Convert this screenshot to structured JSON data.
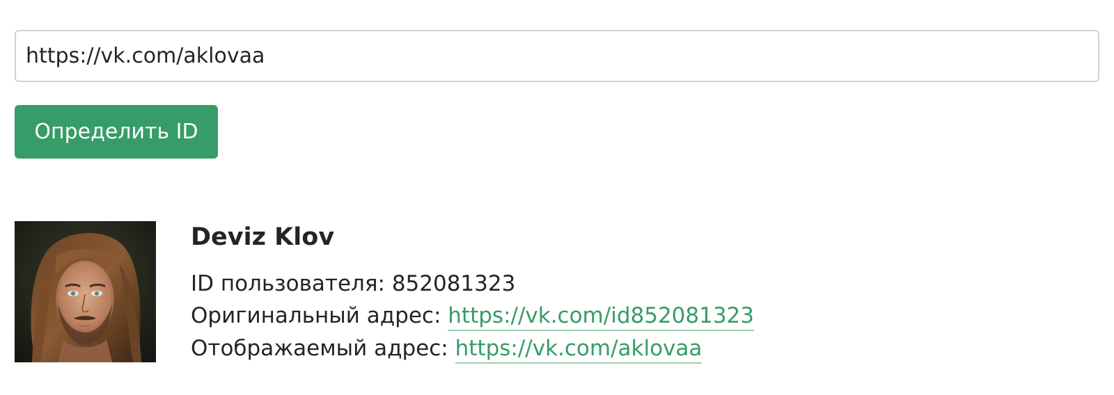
{
  "form": {
    "url_value": "https://vk.com/aklovaa",
    "submit_label": "Определить ID"
  },
  "result": {
    "avatar_icon": "user-photo",
    "name": "Deviz Klov",
    "id_label": "ID пользователя:",
    "id_value": "852081323",
    "original_label": "Оригинальный адрес:",
    "original_url": "https://vk.com/id852081323",
    "display_label": "Отображаемый адрес:",
    "display_url": "https://vk.com/aklovaa"
  },
  "colors": {
    "accent": "#369c68",
    "text": "#212529",
    "input_border": "#ced4da"
  }
}
